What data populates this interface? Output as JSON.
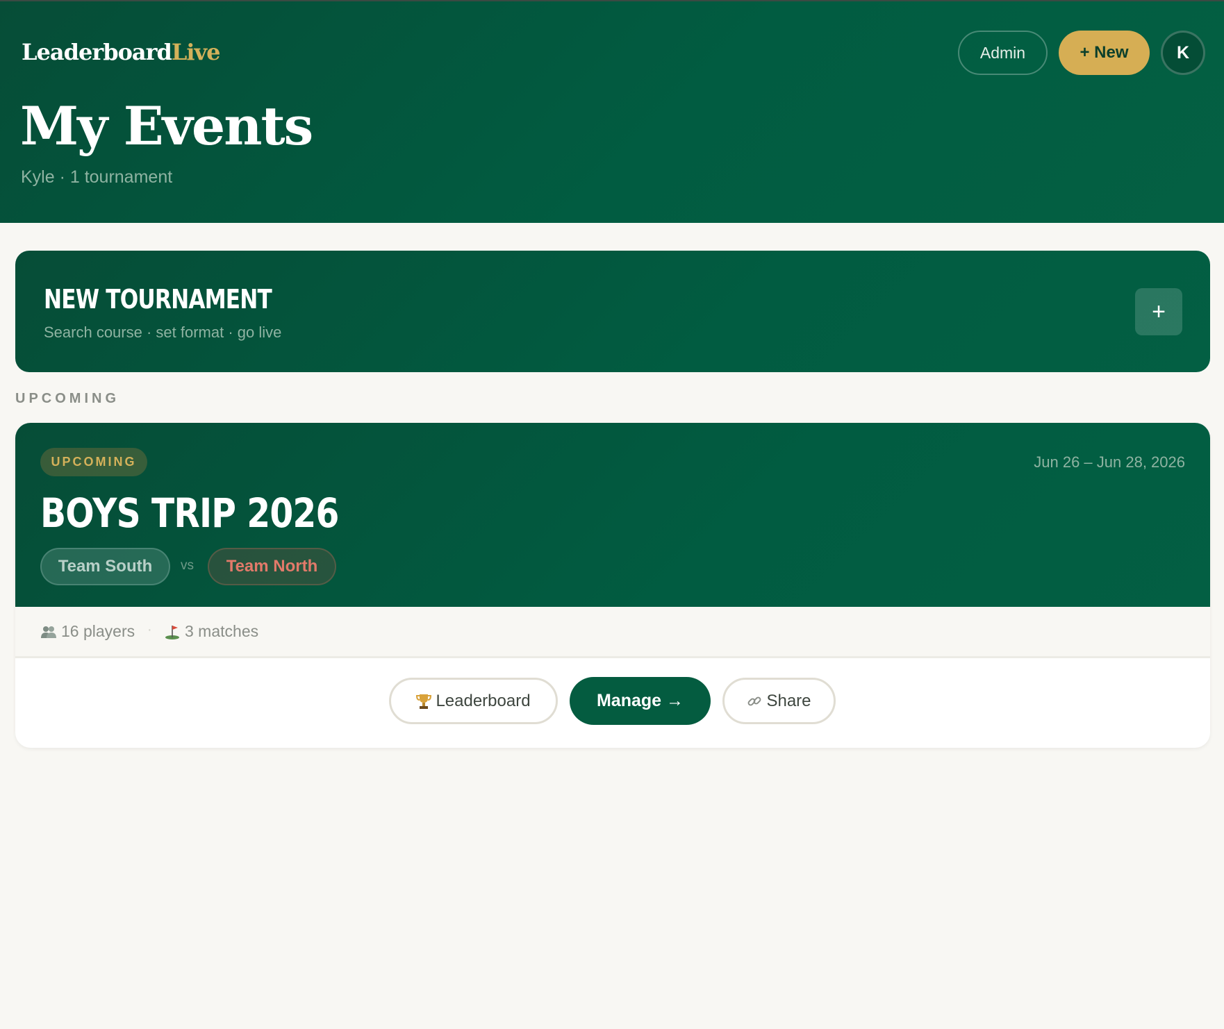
{
  "header": {
    "brand_main": "Leaderboard",
    "brand_accent": "Live",
    "admin_label": "Admin",
    "new_label": "+ New",
    "avatar_initial": "K",
    "page_title": "My Events",
    "subtitle": "Kyle · 1 tournament"
  },
  "new_tournament": {
    "title": "NEW TOURNAMENT",
    "subtitle": "Search course · set format · go live",
    "plus": "+"
  },
  "sections": {
    "upcoming_label": "UPCOMING"
  },
  "event": {
    "status": "UPCOMING",
    "dates": "Jun 26 – Jun 28, 2026",
    "title": "BOYS TRIP 2026",
    "team_a": "Team South",
    "vs": "vs",
    "team_b": "Team North",
    "players": "16 players",
    "matches": "3 matches",
    "leaderboard_label": "Leaderboard",
    "manage_label": "Manage →",
    "share_label": "Share"
  },
  "icons": {
    "players": "players-icon",
    "matches": "golf-flag-icon",
    "leaderboard": "trophy-icon",
    "share": "link-icon"
  },
  "colors": {
    "primary_green": "#015c41",
    "gold_accent": "#d6ae54",
    "team_north": "#e27a6a",
    "background": "#f8f7f3"
  }
}
